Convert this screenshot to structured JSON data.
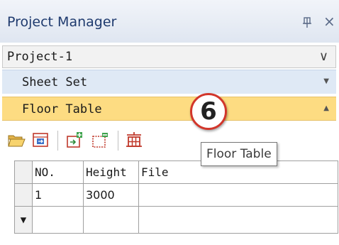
{
  "title": "Project Manager",
  "icons": {
    "pin": "pin-icon",
    "close": "close-icon",
    "project_dropdown": "chevron-down-icon",
    "sheet_set_arrow": "triangle-down-icon",
    "floor_table_arrow": "triangle-up-icon",
    "toolbar": [
      "open-folder-icon",
      "import-table-icon",
      "add-row-icon",
      "delete-row-icon",
      "floor-table-icon"
    ]
  },
  "project_selector": {
    "value": "Project-1",
    "chevron": "∨"
  },
  "categories": [
    {
      "label": "Sheet Set",
      "arrow": "▼",
      "active": false
    },
    {
      "label": "Floor Table",
      "arrow": "▲",
      "active": true
    }
  ],
  "badge": {
    "number": "6"
  },
  "tooltip": "Floor Table",
  "close_glyph": "×",
  "table": {
    "columns": [
      "NO.",
      "Height",
      "File"
    ],
    "rows": [
      [
        "1",
        "3000",
        ""
      ]
    ],
    "new_row_marker": "▼"
  },
  "colors": {
    "title_text": "#1e3a6e",
    "selected_category": "#fddc82",
    "category": "#dfe9f5",
    "badge_border": "#d2362b"
  }
}
